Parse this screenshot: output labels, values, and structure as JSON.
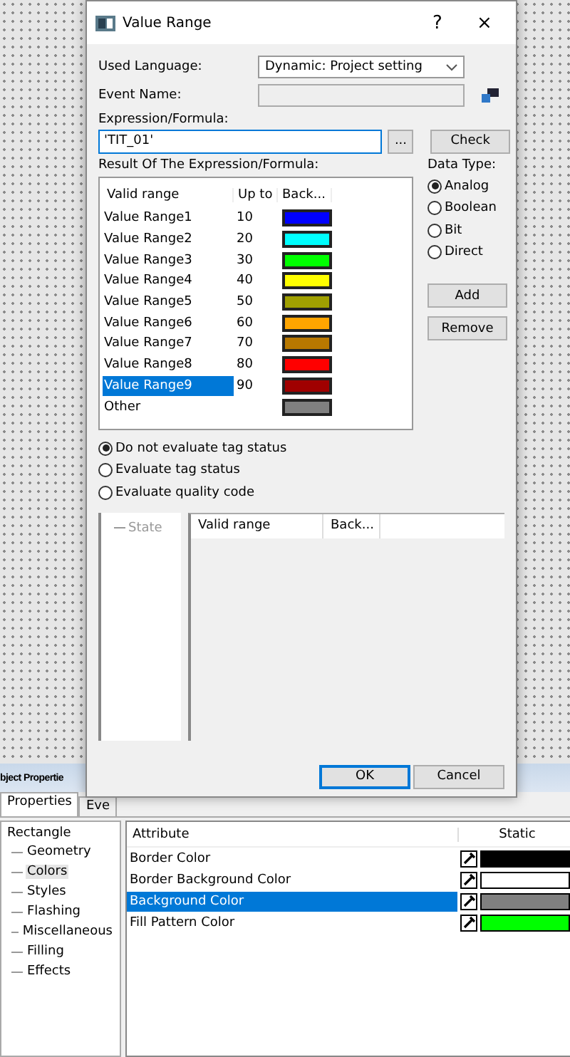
{
  "dialog": {
    "title": "Value Range",
    "help": "?",
    "close": "×",
    "used_language": {
      "label": "Used Language:",
      "value": "Dynamic: Project setting"
    },
    "event_name": {
      "label": "Event Name:",
      "disabled": true
    },
    "expression": {
      "label": "Expression/Formula:",
      "value": "'TIT_01'",
      "browse": "...",
      "check": "Check"
    },
    "result_label": "Result Of The Expression/Formula:",
    "ranges": {
      "columns": [
        "Valid range",
        "Up to",
        "Back..."
      ],
      "rows": [
        {
          "name": "Value Range1",
          "up_to": "10",
          "color": "#0000ff",
          "selected": false
        },
        {
          "name": "Value Range2",
          "up_to": "20",
          "color": "#00ffff",
          "selected": false
        },
        {
          "name": "Value Range3",
          "up_to": "30",
          "color": "#00ff00",
          "selected": false
        },
        {
          "name": "Value Range4",
          "up_to": "40",
          "color": "#ffff00",
          "selected": false
        },
        {
          "name": "Value Range5",
          "up_to": "50",
          "color": "#a0a000",
          "selected": false
        },
        {
          "name": "Value Range6",
          "up_to": "60",
          "color": "#ffa500",
          "selected": false
        },
        {
          "name": "Value Range7",
          "up_to": "70",
          "color": "#b87800",
          "selected": false
        },
        {
          "name": "Value Range8",
          "up_to": "80",
          "color": "#ff0000",
          "selected": false
        },
        {
          "name": "Value Range9",
          "up_to": "90",
          "color": "#a00000",
          "selected": true
        },
        {
          "name": "Other",
          "color": "#808080",
          "selected": false
        }
      ]
    },
    "data_type": {
      "label": "Data Type:",
      "options": [
        {
          "label": "Analog",
          "selected": true
        },
        {
          "label": "Boolean",
          "selected": false
        },
        {
          "label": "Bit",
          "selected": false
        },
        {
          "label": "Direct",
          "selected": false
        }
      ]
    },
    "list_buttons": [
      "Add",
      "Remove"
    ],
    "tag_status": [
      {
        "label": "Do not evaluate tag status",
        "selected": true
      },
      {
        "label": "Evaluate tag status",
        "selected": false
      },
      {
        "label": "Evaluate quality code",
        "selected": false
      }
    ],
    "state_tree": {
      "items": [
        {
          "label": "State",
          "disabled": true
        }
      ]
    },
    "state_table": {
      "columns": [
        "Valid range",
        "Back..."
      ]
    },
    "buttons": [
      {
        "label": "OK",
        "default": true
      },
      {
        "label": "Cancel",
        "default": false
      }
    ]
  },
  "object_properties": {
    "title": "bject Propertie",
    "tabs": [
      {
        "label": "Properties",
        "selected": true
      },
      {
        "label": "Eve",
        "selected": false
      }
    ],
    "tree": {
      "label": "Rectangle",
      "children": [
        {
          "label": "Geometry",
          "selected": false
        },
        {
          "label": "Colors",
          "selected": true
        },
        {
          "label": "Styles",
          "selected": false
        },
        {
          "label": "Flashing",
          "selected": false
        },
        {
          "label": "Miscellaneous",
          "selected": false
        },
        {
          "label": "Filling",
          "selected": false
        },
        {
          "label": "Effects",
          "selected": false
        }
      ]
    },
    "table": {
      "columns": [
        "Attribute",
        "Static"
      ],
      "rows": [
        {
          "attribute": "Border Color",
          "color": "#000000",
          "selected": false
        },
        {
          "attribute": "Border Background Color",
          "color": "#ffffff",
          "selected": false
        },
        {
          "attribute": "Background Color",
          "color": "#808080",
          "selected": true
        },
        {
          "attribute": "Fill Pattern Color",
          "color": "#00ff00",
          "selected": false
        }
      ]
    }
  }
}
